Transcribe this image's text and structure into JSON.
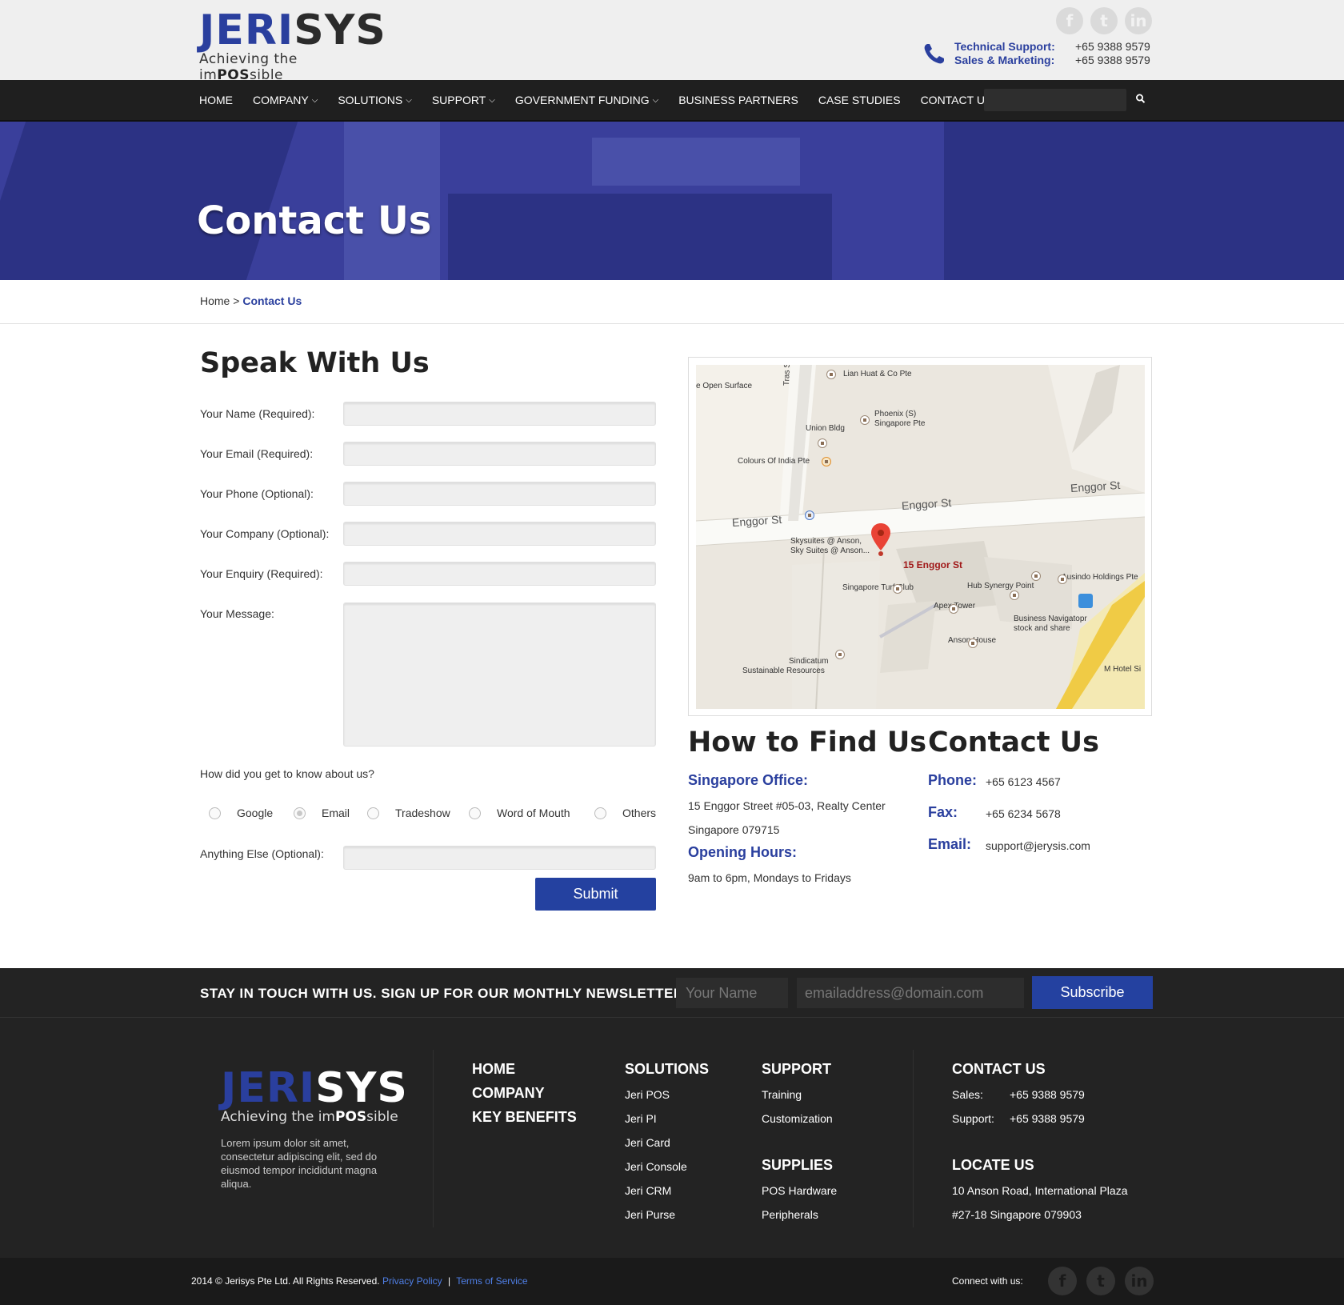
{
  "brand": {
    "name_a": "JERI",
    "name_b": "SYS",
    "tagline_a": "Achieving the im",
    "tagline_b": "POS",
    "tagline_c": "sible",
    "accent_color": "#2a3f9e"
  },
  "header": {
    "social": [
      "f",
      "t",
      "in"
    ],
    "support_label": "Technical Support:",
    "support_number": "+65 9388 9579",
    "sales_label": "Sales & Marketing:",
    "sales_number": "+65 9388 9579"
  },
  "nav": {
    "items": [
      {
        "label": "HOME",
        "dropdown": false
      },
      {
        "label": "COMPANY",
        "dropdown": true
      },
      {
        "label": "SOLUTIONS",
        "dropdown": true
      },
      {
        "label": "SUPPORT",
        "dropdown": true
      },
      {
        "label": "GOVERNMENT FUNDING",
        "dropdown": true
      },
      {
        "label": "BUSINESS PARTNERS",
        "dropdown": false
      },
      {
        "label": "CASE STUDIES",
        "dropdown": false
      },
      {
        "label": "CONTACT US",
        "dropdown": false
      }
    ],
    "search_icon": "search-icon"
  },
  "hero": {
    "title": "Contact Us"
  },
  "breadcrumb": {
    "home": "Home",
    "sep": ">",
    "current": "Contact Us"
  },
  "form": {
    "title": "Speak With Us",
    "fields": [
      {
        "label": "Your Name (Required):"
      },
      {
        "label": "Your Email (Required):"
      },
      {
        "label": "Your Phone (Optional):"
      },
      {
        "label": "Your Company (Optional):"
      },
      {
        "label": "Your Enquiry (Required):"
      }
    ],
    "message_label": "Your Message:",
    "question": "How did you get to know about us?",
    "options": [
      {
        "label": "Google",
        "checked": false
      },
      {
        "label": "Email",
        "checked": true
      },
      {
        "label": "Tradeshow",
        "checked": false
      },
      {
        "label": "Word of Mouth",
        "checked": false
      },
      {
        "label": "Others",
        "checked": false
      }
    ],
    "anything_label": "Anything Else (Optional):",
    "submit_label": "Submit"
  },
  "map": {
    "labels": {
      "lian_huat": "Lian Huat & Co Pte",
      "open_surface": "e Open Surface",
      "phoenix": "Phoenix (S)",
      "phoenix2": "Singapore Pte",
      "union": "Union Bldg",
      "colours": "Colours Of India Pte",
      "tras": "Tras St",
      "enggor_left": "Enggor St",
      "enggor_mid": "Enggor St",
      "enggor_right": "Enggor St",
      "skysuites": "Skysuites @ Anson,",
      "skysuites2": "Sky Suites @ Anson...",
      "pin": "15 Enggor St",
      "turf": "Singapore Turf Club",
      "hub": "Hub Synergy Point",
      "ausindo": "Ausindo Holdings Pte",
      "apex": "Apex Tower",
      "bizn": "Business Navigatopr",
      "bizn2": "stock and share",
      "anson": "Anson House",
      "sindicatum": "Sindicatum",
      "sindicatum2": "Sustainable Resources",
      "mhotel": "M Hotel Si"
    }
  },
  "find": {
    "title": "How to Find Us",
    "office_h": "Singapore Office:",
    "address1": "15 Enggor Street #05-03, Realty Center",
    "address2": "Singapore 079715",
    "hours_h": "Opening Hours:",
    "hours": "9am to 6pm, Mondays to Fridays"
  },
  "contact": {
    "title": "Contact Us",
    "phone_label": "Phone:",
    "phone": "+65 6123 4567",
    "fax_label": "Fax:",
    "fax": "+65 6234 5678",
    "email_label": "Email:",
    "email": "support@jerysis.com"
  },
  "newsletter": {
    "text": "STAY IN TOUCH WITH US. SIGN UP FOR OUR MONTHLY NEWSLETTER:",
    "name_placeholder": "Your Name",
    "email_placeholder": "emailaddress@domain.com",
    "button": "Subscribe"
  },
  "footer": {
    "about": "Lorem ipsum dolor sit amet, consectetur adipiscing elit, sed do eiusmod tempor incididunt magna aliqua.",
    "main_links": [
      "HOME",
      "COMPANY",
      "KEY BENEFITS"
    ],
    "solutions_h": "SOLUTIONS",
    "solutions": [
      "Jeri POS",
      "Jeri PI",
      "Jeri Card",
      "Jeri Console",
      "Jeri CRM",
      "Jeri Purse"
    ],
    "support_h": "SUPPORT",
    "support": [
      "Training",
      "Customization"
    ],
    "supplies_h": "SUPPLIES",
    "supplies": [
      "POS Hardware",
      "Peripherals"
    ],
    "contact_h": "CONTACT US",
    "sales_label": "Sales:",
    "sales": "+65 9388 9579",
    "support_label": "Support:",
    "support_num": "+65 9388 9579",
    "locate_h": "LOCATE US",
    "locate1": "10 Anson Road, International Plaza",
    "locate2": "#27-18 Singapore 079903"
  },
  "bottom": {
    "copyright": "2014 © Jerisys Pte Ltd. All Rights Reserved.",
    "privacy": "Privacy Policy",
    "sep": "|",
    "terms": "Terms of Service",
    "connect": "Connect with us:",
    "social": [
      "f",
      "t",
      "in"
    ]
  }
}
